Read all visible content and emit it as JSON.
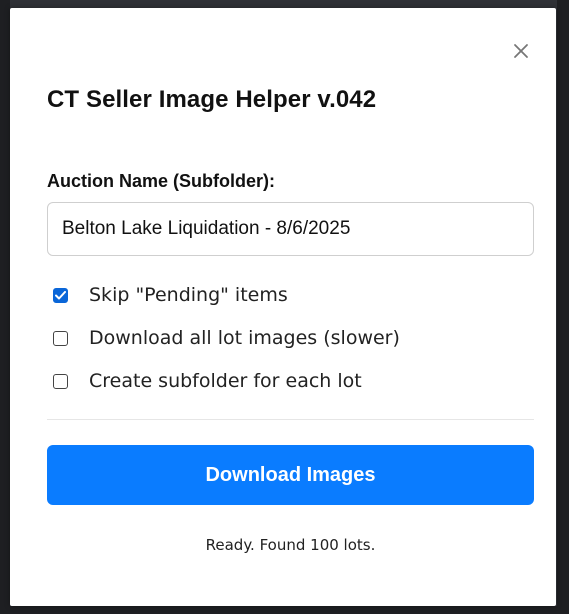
{
  "popup": {
    "title": "CT Seller Image Helper v.042",
    "close_icon": "close-icon"
  },
  "auction": {
    "label": "Auction Name (Subfolder):",
    "value": "Belton Lake Liquidation - 8/6/2025"
  },
  "options": [
    {
      "label": "Skip \"Pending\" items",
      "checked": true
    },
    {
      "label": "Download all lot images (slower)",
      "checked": false
    },
    {
      "label": "Create subfolder for each lot",
      "checked": false
    }
  ],
  "actions": {
    "download_label": "Download Images"
  },
  "status": {
    "text": "Ready. Found 100 lots."
  },
  "colors": {
    "primary": "#0a7cff",
    "checkbox_accent": "#0a66d8"
  }
}
